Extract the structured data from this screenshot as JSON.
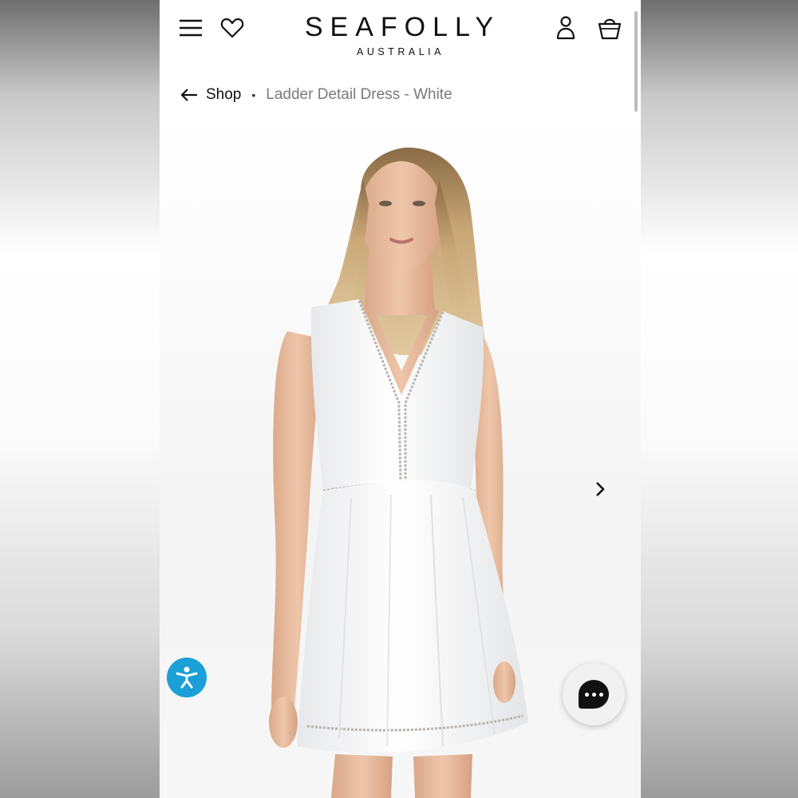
{
  "brand": {
    "name": "SEAFOLLY",
    "tagline": "AUSTRALIA"
  },
  "header": {
    "icons": [
      "menu-icon",
      "heart-icon",
      "account-icon",
      "bag-icon"
    ]
  },
  "breadcrumb": {
    "back_label": "Shop",
    "separator": "•",
    "current": "Ladder Detail Dress - White"
  },
  "gallery": {
    "next_icon": "chevron-right-icon"
  },
  "widgets": {
    "accessibility_icon": "accessibility-icon",
    "chat_icon": "chat-icon"
  },
  "colors": {
    "accessibility_button": "#1a9fd6",
    "chat_bubble": "#111111",
    "text_primary": "#111111",
    "text_muted": "#7a7a7a"
  }
}
